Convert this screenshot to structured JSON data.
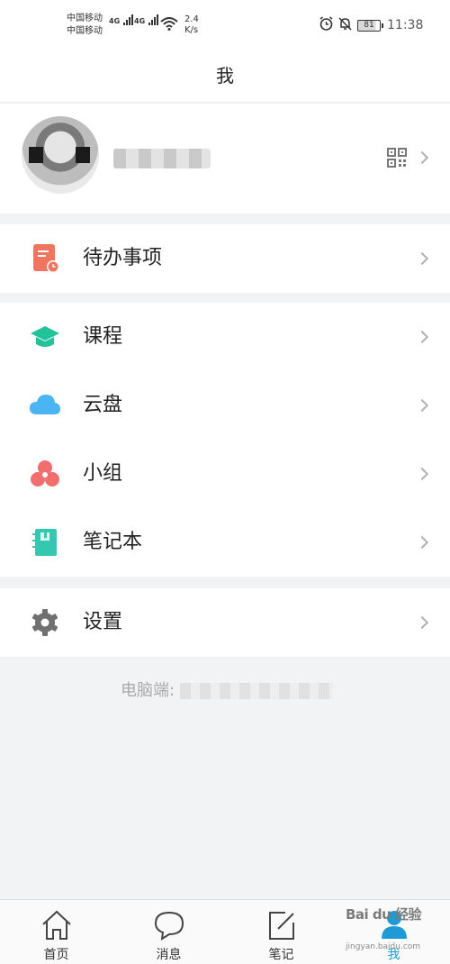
{
  "status_bar": {
    "carrier1": "中国移动",
    "carrier2": "中国移动",
    "net1": "4G",
    "net2": "4G",
    "speed_value": "2.4",
    "speed_unit": "K/s",
    "battery": "81",
    "time": "11:38"
  },
  "header": {
    "title": "我"
  },
  "profile": {
    "name": "···"
  },
  "menu": {
    "todo": "待办事项",
    "course": "课程",
    "cloud": "云盘",
    "group": "小组",
    "notebook": "笔记本",
    "settings": "设置"
  },
  "footer": {
    "pc_label": "电脑端:"
  },
  "tabs": [
    {
      "label": "首页"
    },
    {
      "label": "消息"
    },
    {
      "label": "笔记"
    },
    {
      "label": "我"
    }
  ],
  "watermark": {
    "line1": "Bai du 经验",
    "line2": "jingyan.baidu.com"
  },
  "colors": {
    "todo": "#f07561",
    "course": "#22c39b",
    "cloud": "#4ab5f2",
    "group": "#f26d6d",
    "notebook": "#35c8b0",
    "settings": "#707070",
    "active_tab": "#1e9bd7"
  },
  "icons": {
    "todo": "todo-calendar-icon",
    "course": "graduation-cap-icon",
    "cloud": "cloud-icon",
    "group": "group-icon",
    "notebook": "notebook-icon",
    "settings": "gear-icon"
  }
}
